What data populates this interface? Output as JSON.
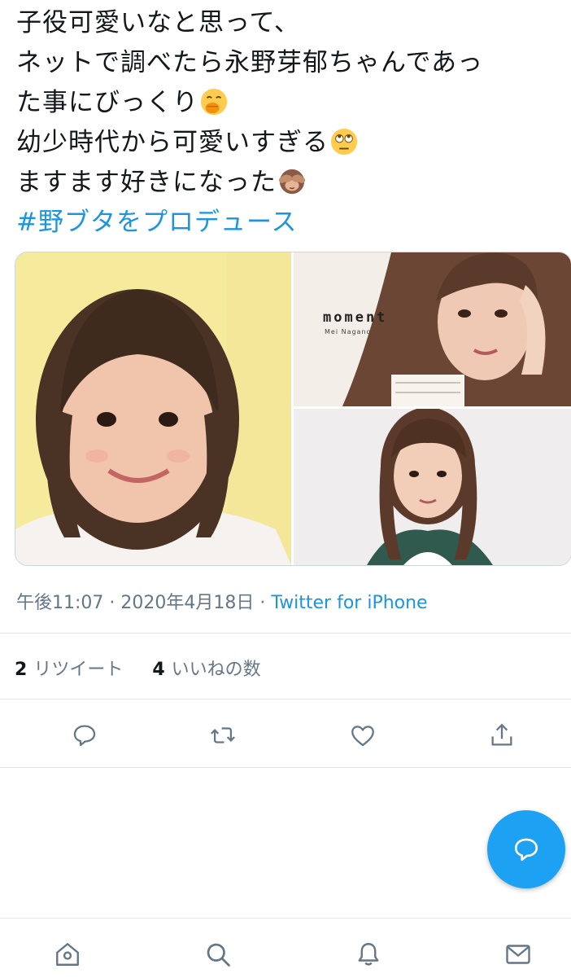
{
  "tweet": {
    "lines": [
      {
        "text": "子役可愛いなと思って、",
        "emoji": ""
      },
      {
        "text": "ネットで調べたら永野芽郁ちゃんであっ",
        "emoji": ""
      },
      {
        "text": "た事にびっくり",
        "emoji": "face-with-hand-over-mouth-emoji"
      },
      {
        "text": "幼少時代から可愛いすぎる",
        "emoji": "face-with-rolling-eyes-emoji"
      },
      {
        "text": "ますます好きになった",
        "emoji": "see-no-evil-monkey-emoji"
      }
    ],
    "hashtag": "#野ブタをプロデュース"
  },
  "media": {
    "photo2_title": "moment",
    "photo2_subtitle": "Mei Nagano"
  },
  "meta": {
    "time": "午後11:07",
    "separator": " · ",
    "date": "2020年4月18日",
    "source": "Twitter for iPhone"
  },
  "stats": {
    "retweet_count": "2",
    "retweet_label": "リツイート",
    "like_count": "4",
    "like_label": "いいねの数"
  },
  "actions": [
    "reply-icon",
    "retweet-icon",
    "like-icon",
    "share-icon"
  ],
  "tabs": [
    "home-icon",
    "search-icon",
    "notifications-icon",
    "messages-icon"
  ],
  "colors": {
    "accent": "#1da1f2",
    "link": "#1b95e0",
    "muted": "#657786",
    "text": "#14171a",
    "divider": "#e1e8ed"
  }
}
